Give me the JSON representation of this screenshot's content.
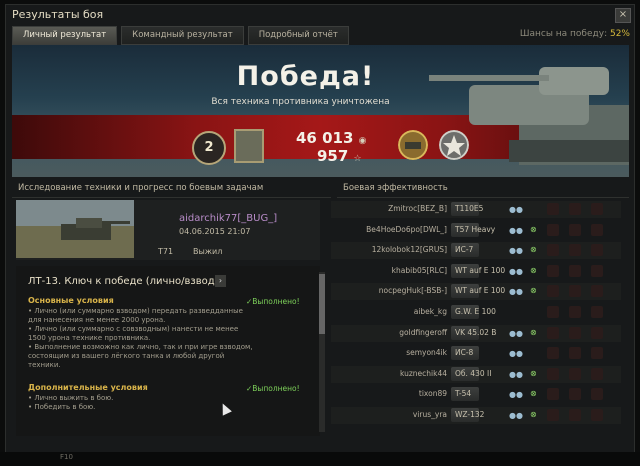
{
  "window": {
    "title": "Результаты боя",
    "win_chance_label": "Шансы на победу:",
    "win_chance_value": "52%",
    "close_glyph": "×"
  },
  "tabs": [
    {
      "label": "Личный результат",
      "active": true
    },
    {
      "label": "Командный результат",
      "active": false
    },
    {
      "label": "Подробный отчёт",
      "active": false
    }
  ],
  "banner": {
    "headline": "Победа!",
    "subtitle": "Вся техника противника уничтожена",
    "rank": "2",
    "credits": "46 013",
    "xp": "957",
    "credits_icon": "credits-icon",
    "xp_icon": "☆"
  },
  "left_panel": {
    "header": "Исследование техники и прогресс по боевым задачам",
    "vehicle": {
      "player": "aidarchik77[_BUG_]",
      "date": "04.06.2015 21:07",
      "tank": "T71",
      "status": "Выжил"
    },
    "mission": {
      "title": "ЛТ-13. Ключ к победе (лично/взвод)",
      "arrow": "›",
      "main_label": "Основные условия",
      "main_done": "✓Выполнено!",
      "main_lines": [
        "• Лично (или суммарно взводом) передать разведданные",
        "для нанесения не менее 2000 урона.",
        "• Лично (или суммарно с совзводным) нанести не менее",
        "1500 урона технике противника.",
        "• Выполнение возможно как лично, так и при игре взводом,",
        "состоящим из вашего лёгкого танка и любой другой",
        "техники."
      ],
      "extra_label": "Дополнительные условия",
      "extra_done": "✓Выполнено!",
      "extra_lines": [
        "• Лично выжить в бою.",
        "• Победить в бою."
      ]
    }
  },
  "right_panel": {
    "header": "Боевая эффективность",
    "rows": [
      {
        "player": "Zmitroc[BEZ_B]",
        "tank": "T110E5",
        "eye": "●●",
        "link": ""
      },
      {
        "player": "Be4HoeDo6po[DWL_]",
        "tank": "T57 Heavy",
        "eye": "●●",
        "link": "⊗"
      },
      {
        "player": "12kolobok12[GRUS]",
        "tank": "ИС-7",
        "eye": "●●",
        "link": "⊗"
      },
      {
        "player": "khabib05[RLC]",
        "tank": "WT auf E 100",
        "eye": "●●",
        "link": "⊗"
      },
      {
        "player": "nocpegHuk[-BSB-]",
        "tank": "WT auf E 100",
        "eye": "●●",
        "link": "⊗"
      },
      {
        "player": "aibek_kg",
        "tank": "G.W. E 100",
        "eye": "",
        "link": ""
      },
      {
        "player": "goldfingeroff",
        "tank": "VK 45.02 B",
        "eye": "●●",
        "link": "⊗"
      },
      {
        "player": "semyon4ik",
        "tank": "ИС-8",
        "eye": "●●",
        "link": ""
      },
      {
        "player": "kuznechik44",
        "tank": "Об. 430 II",
        "eye": "●●",
        "link": "⊗"
      },
      {
        "player": "tixon89",
        "tank": "T-54",
        "eye": "●●",
        "link": "⊗"
      },
      {
        "player": "virus_yra",
        "tank": "WZ-132",
        "eye": "●●",
        "link": "⊗"
      }
    ]
  },
  "bottom": {
    "text": "F10"
  },
  "colors": {
    "accent_red": "#a51818",
    "gold": "#d5b93b",
    "done_green": "#7dd05a",
    "player_purple": "#b88cc8"
  }
}
